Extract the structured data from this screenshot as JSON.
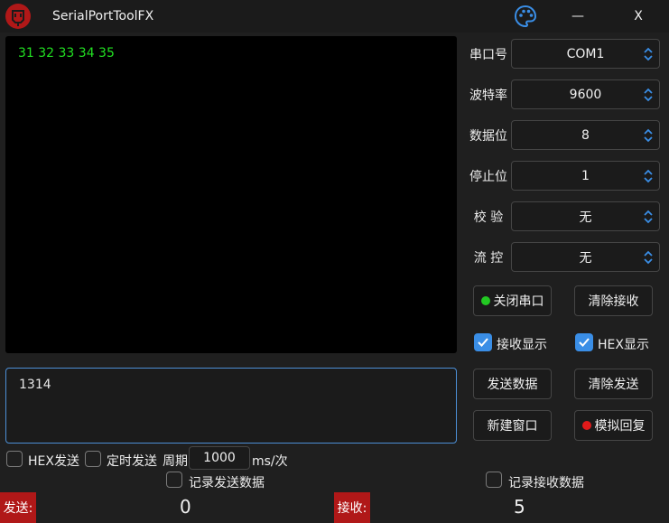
{
  "window": {
    "title": "SerialPortToolFX",
    "minimize_label": "—",
    "close_label": "X"
  },
  "receive": {
    "text": "31 32 33 34 35"
  },
  "send": {
    "text": "1314"
  },
  "settings": {
    "port": {
      "label": "串口号",
      "value": "COM1"
    },
    "baud": {
      "label": "波特率",
      "value": "9600"
    },
    "data_bits": {
      "label": "数据位",
      "value": "8"
    },
    "stop_bits": {
      "label": "停止位",
      "value": "1"
    },
    "parity": {
      "label": "校 验",
      "value": "无"
    },
    "flow": {
      "label": "流 控",
      "value": "无"
    }
  },
  "buttons": {
    "close_port": "关闭串口",
    "clear_receive": "清除接收",
    "send_data": "发送数据",
    "clear_send": "清除发送",
    "new_window": "新建窗口",
    "sim_reply": "模拟回复"
  },
  "checkboxes": {
    "receive_display": {
      "label": "接收显示",
      "checked": true
    },
    "hex_display": {
      "label": "HEX显示",
      "checked": true
    },
    "hex_send": {
      "label": "HEX发送",
      "checked": false
    },
    "timed_send": {
      "label": "定时发送",
      "checked": false
    },
    "log_send": {
      "label": "记录发送数据",
      "checked": false
    },
    "log_receive": {
      "label": "记录接收数据",
      "checked": false
    }
  },
  "period": {
    "label": "周期",
    "value": "1000",
    "unit": "ms/次"
  },
  "status": {
    "sent_label": "发送:",
    "sent_count": "0",
    "received_label": "接收:",
    "received_count": "5"
  },
  "colors": {
    "accent": "#3a8ee6",
    "receive_text": "#22e022",
    "port_open_indicator": "#22c922",
    "sim_reply_indicator": "#e01a1a",
    "status_tag": "#b01818"
  },
  "icons": {
    "app_logo": "serial-plug-icon",
    "theme": "palette-icon"
  }
}
